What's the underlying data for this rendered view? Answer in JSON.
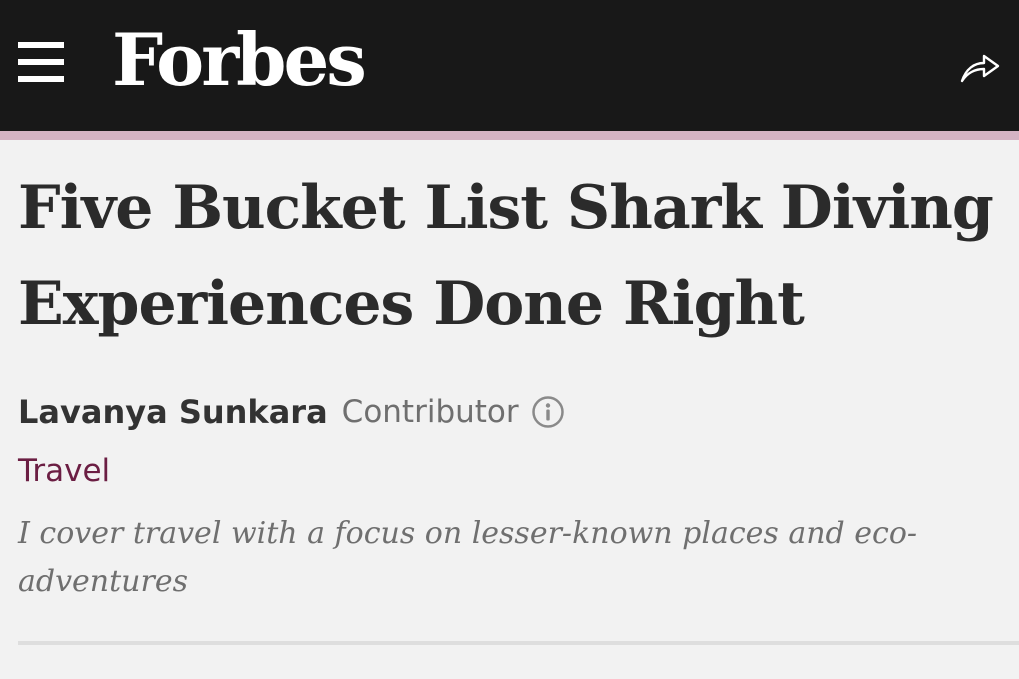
{
  "header": {
    "brand": "Forbes",
    "menu_icon": "hamburger-menu-icon",
    "share_icon": "share-arrow-icon"
  },
  "article": {
    "headline": "Five Bucket List Shark Diving Experiences Done Right",
    "author": "Lavanya Sunkara",
    "author_role": "Contributor",
    "info_icon": "info-icon",
    "section": "Travel",
    "author_bio": "I cover travel with a focus on lesser-known places and eco-adventures"
  },
  "colors": {
    "header_background": "#181818",
    "accent_strip": "#d4b3c3",
    "section_link": "#6b1e43",
    "page_background": "#f2f2f2"
  }
}
